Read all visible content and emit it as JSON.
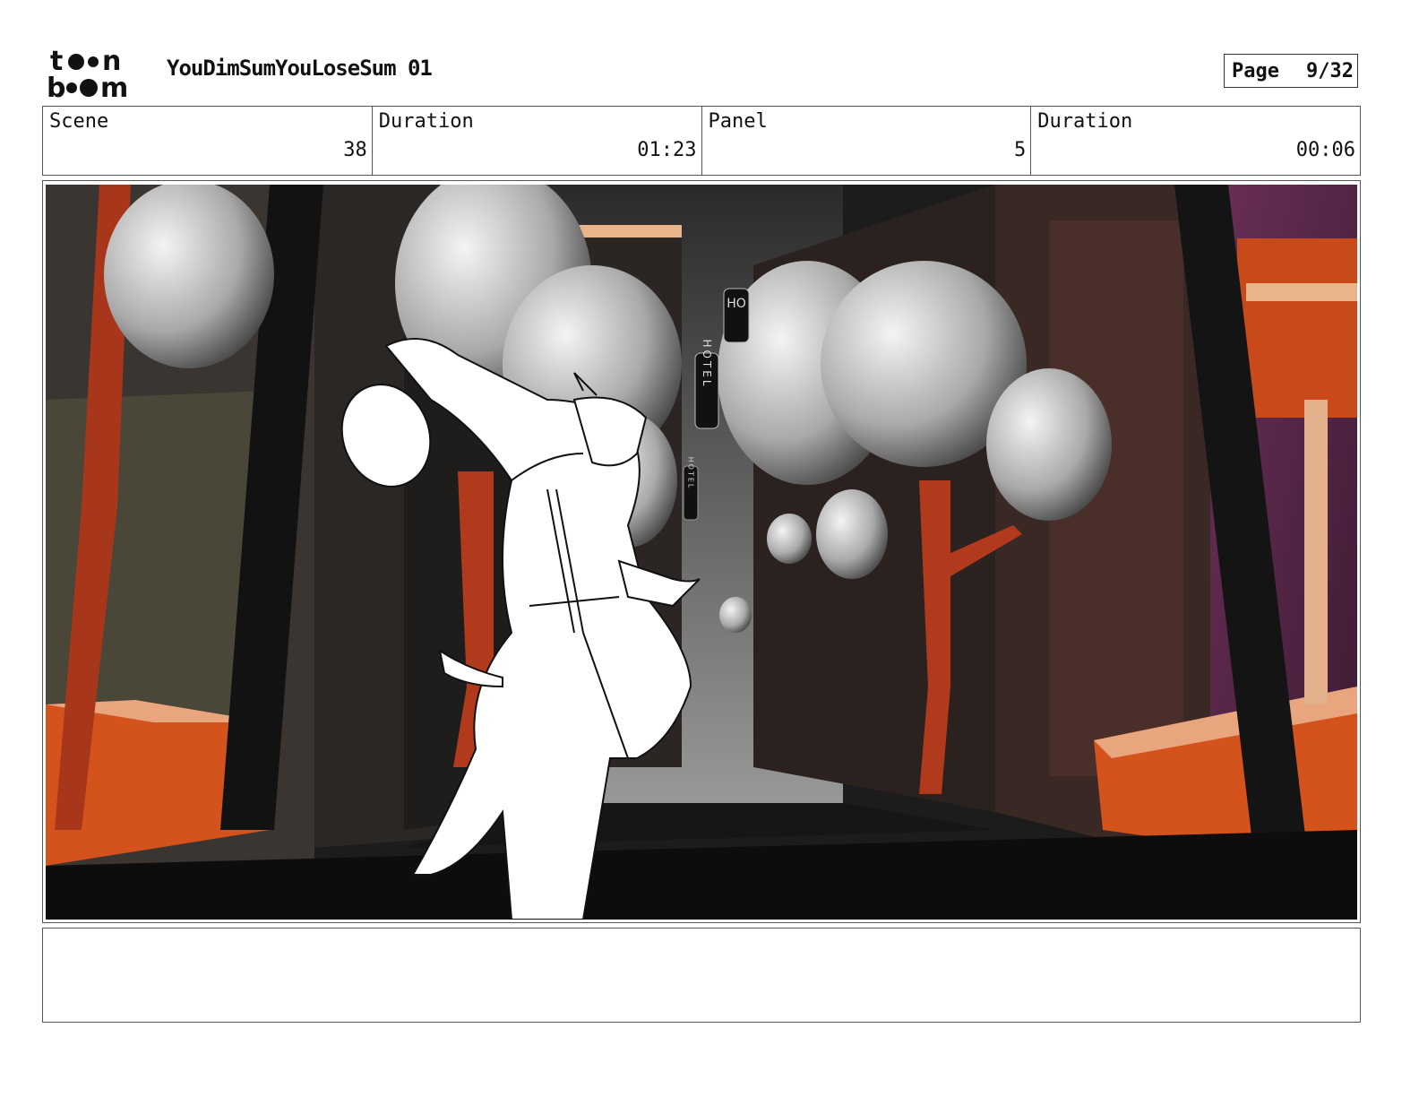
{
  "header": {
    "logo_text": "toonboom",
    "title": "YouDimSumYouLoseSum 01",
    "page_label": "Page",
    "page_value": "9/32"
  },
  "info": {
    "scene_label": "Scene",
    "scene_value": "38",
    "scene_duration_label": "Duration",
    "scene_duration_value": "01:23",
    "panel_label": "Panel",
    "panel_value": "5",
    "panel_duration_label": "Duration",
    "panel_duration_value": "00:06"
  },
  "panel": {
    "signs": [
      "HO",
      "HOTEL",
      "HOTEL"
    ]
  },
  "notes": {
    "text": ""
  }
}
